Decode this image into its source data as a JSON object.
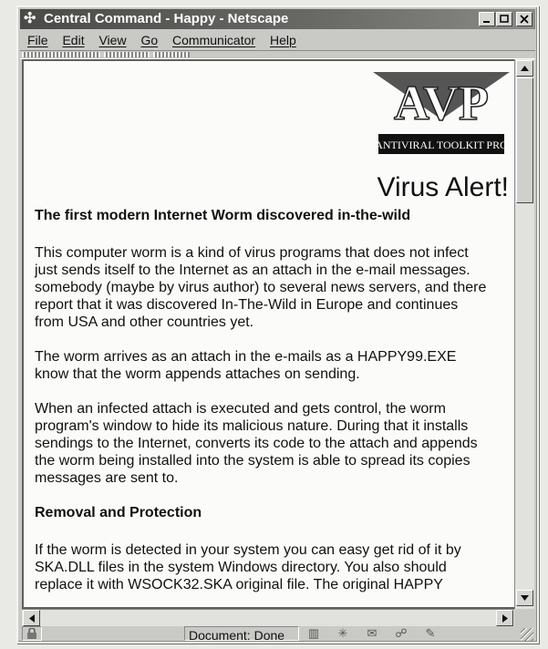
{
  "window": {
    "title": "Central Command - Happy - Netscape"
  },
  "menu": [
    "File",
    "Edit",
    "View",
    "Go",
    "Communicator",
    "Help"
  ],
  "page": {
    "logo": {
      "brand": "AVP",
      "tagline": "AntiViral Toolkit Pro"
    },
    "alert_title": "Virus Alert!",
    "heading1": "The first modern Internet Worm discovered in-the-wild",
    "para1": [
      "This computer worm is a kind of virus programs that does not infect",
      "just sends itself to the Internet as an attach in the e-mail messages.",
      "somebody (maybe by virus author) to several news servers, and there",
      "report that it was discovered In-The-Wild in Europe and continues",
      "from USA and other countries yet."
    ],
    "para2": [
      "The worm arrives as an attach in the e-mails as a HAPPY99.EXE",
      "know that the worm appends attaches on sending."
    ],
    "para3": [
      "When an infected attach is executed and gets control, the worm",
      "program's window to hide its malicious nature. During that it installs",
      "sendings to the Internet, converts its code to the attach and appends",
      "the worm being installed into the system is able to spread its copies",
      "messages are sent to."
    ],
    "heading2": "Removal and Protection",
    "para4": [
      "If the worm is detected in your system you can easy get rid of it by",
      "SKA.DLL files in the system Windows directory. You also should",
      "replace it with WSOCK32.SKA original file. The original HAPPY"
    ]
  },
  "status": {
    "text": "Document: Done"
  },
  "icons": {
    "app": "netscape-icon",
    "minimize": "minimize-icon",
    "maximize": "maximize-icon",
    "close": "close-icon",
    "scroll_up": "arrow-up-icon",
    "scroll_down": "arrow-down-icon",
    "scroll_left": "arrow-left-icon",
    "scroll_right": "arrow-right-icon",
    "security": "lock-icon"
  }
}
